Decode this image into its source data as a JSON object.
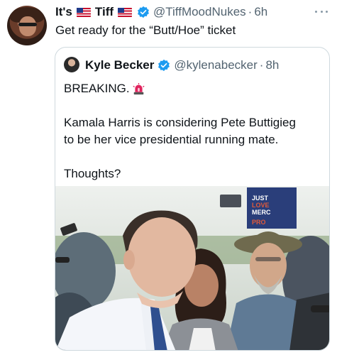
{
  "author": {
    "name_part1": "It's",
    "name_part2": "Tiff",
    "handle": "@TiffMoodNukes",
    "separator": "·",
    "time": "6h",
    "verified": true,
    "flag_icon": "us-flag-icon"
  },
  "tweet": {
    "text": "Get ready for the “Butt/Hoe” ticket"
  },
  "quoted": {
    "name": "Kyle Becker",
    "handle": "@kylenabecker",
    "separator": "·",
    "time": "8h",
    "verified": true,
    "lines": [
      "BREAKING.",
      "Kamala Harris is considering Pete Buttigieg",
      "to be her vice presidential running mate.",
      "Thoughts?"
    ],
    "photo": {
      "sign_lines": [
        "JUST",
        "LOVE",
        "MERC",
        "PRO"
      ]
    }
  },
  "colors": {
    "text": "#0f1419",
    "secondary": "#536471",
    "verified_blue": "#1d9bf0",
    "border": "#cfd9de"
  }
}
